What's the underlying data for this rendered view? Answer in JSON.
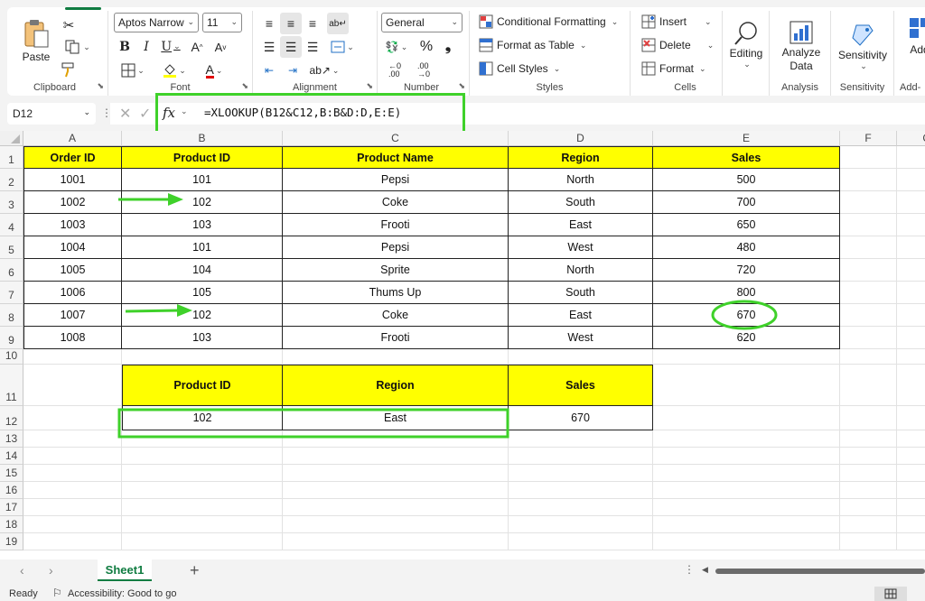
{
  "ribbon": {
    "clipboard": {
      "paste": "Paste",
      "label": "Clipboard"
    },
    "font": {
      "name": "Aptos Narrow",
      "size": "11",
      "label": "Font"
    },
    "alignment": {
      "label": "Alignment"
    },
    "number": {
      "format": "General",
      "label": "Number"
    },
    "styles": {
      "conditional": "Conditional Formatting",
      "table": "Format as Table",
      "cell": "Cell Styles",
      "label": "Styles"
    },
    "cells": {
      "insert": "Insert",
      "delete": "Delete",
      "format": "Format",
      "label": "Cells"
    },
    "editing": {
      "label": "Editing"
    },
    "analysis": {
      "analyze": "Analyze",
      "data": "Data",
      "label": "Analysis"
    },
    "sensitivity": {
      "btn": "Sensitivity",
      "label": "Sensitivity"
    },
    "addins": {
      "btn": "Add",
      "label": "Add-"
    }
  },
  "formula_bar": {
    "name_box": "D12",
    "fx": "fx",
    "formula": "=XLOOKUP(B12&C12,B:B&D:D,E:E)"
  },
  "columns": [
    "A",
    "B",
    "C",
    "D",
    "E",
    "F",
    "G"
  ],
  "rows": [
    "1",
    "2",
    "3",
    "4",
    "5",
    "6",
    "7",
    "8",
    "9",
    "10",
    "11",
    "12",
    "13",
    "14",
    "15",
    "16",
    "17",
    "18",
    "19"
  ],
  "table": {
    "headers": [
      "Order ID",
      "Product ID",
      "Product Name",
      "Region",
      "Sales"
    ],
    "rows": [
      [
        "1001",
        "101",
        "Pepsi",
        "North",
        "500"
      ],
      [
        "1002",
        "102",
        "Coke",
        "South",
        "700"
      ],
      [
        "1003",
        "103",
        "Frooti",
        "East",
        "650"
      ],
      [
        "1004",
        "101",
        "Pepsi",
        "West",
        "480"
      ],
      [
        "1005",
        "104",
        "Sprite",
        "North",
        "720"
      ],
      [
        "1006",
        "105",
        "Thums Up",
        "South",
        "800"
      ],
      [
        "1007",
        "102",
        "Coke",
        "East",
        "670"
      ],
      [
        "1008",
        "103",
        "Frooti",
        "West",
        "620"
      ]
    ]
  },
  "lookup": {
    "headers": [
      "Product ID",
      "Region",
      "Sales"
    ],
    "values": [
      "102",
      "East",
      "670"
    ]
  },
  "sheet_tab": "Sheet1",
  "status": {
    "ready": "Ready",
    "accessibility": "Accessibility: Good to go"
  },
  "colors": {
    "highlight_green": "#3fd12a",
    "header_yellow": "#ffff00",
    "excel_green": "#107c41"
  }
}
